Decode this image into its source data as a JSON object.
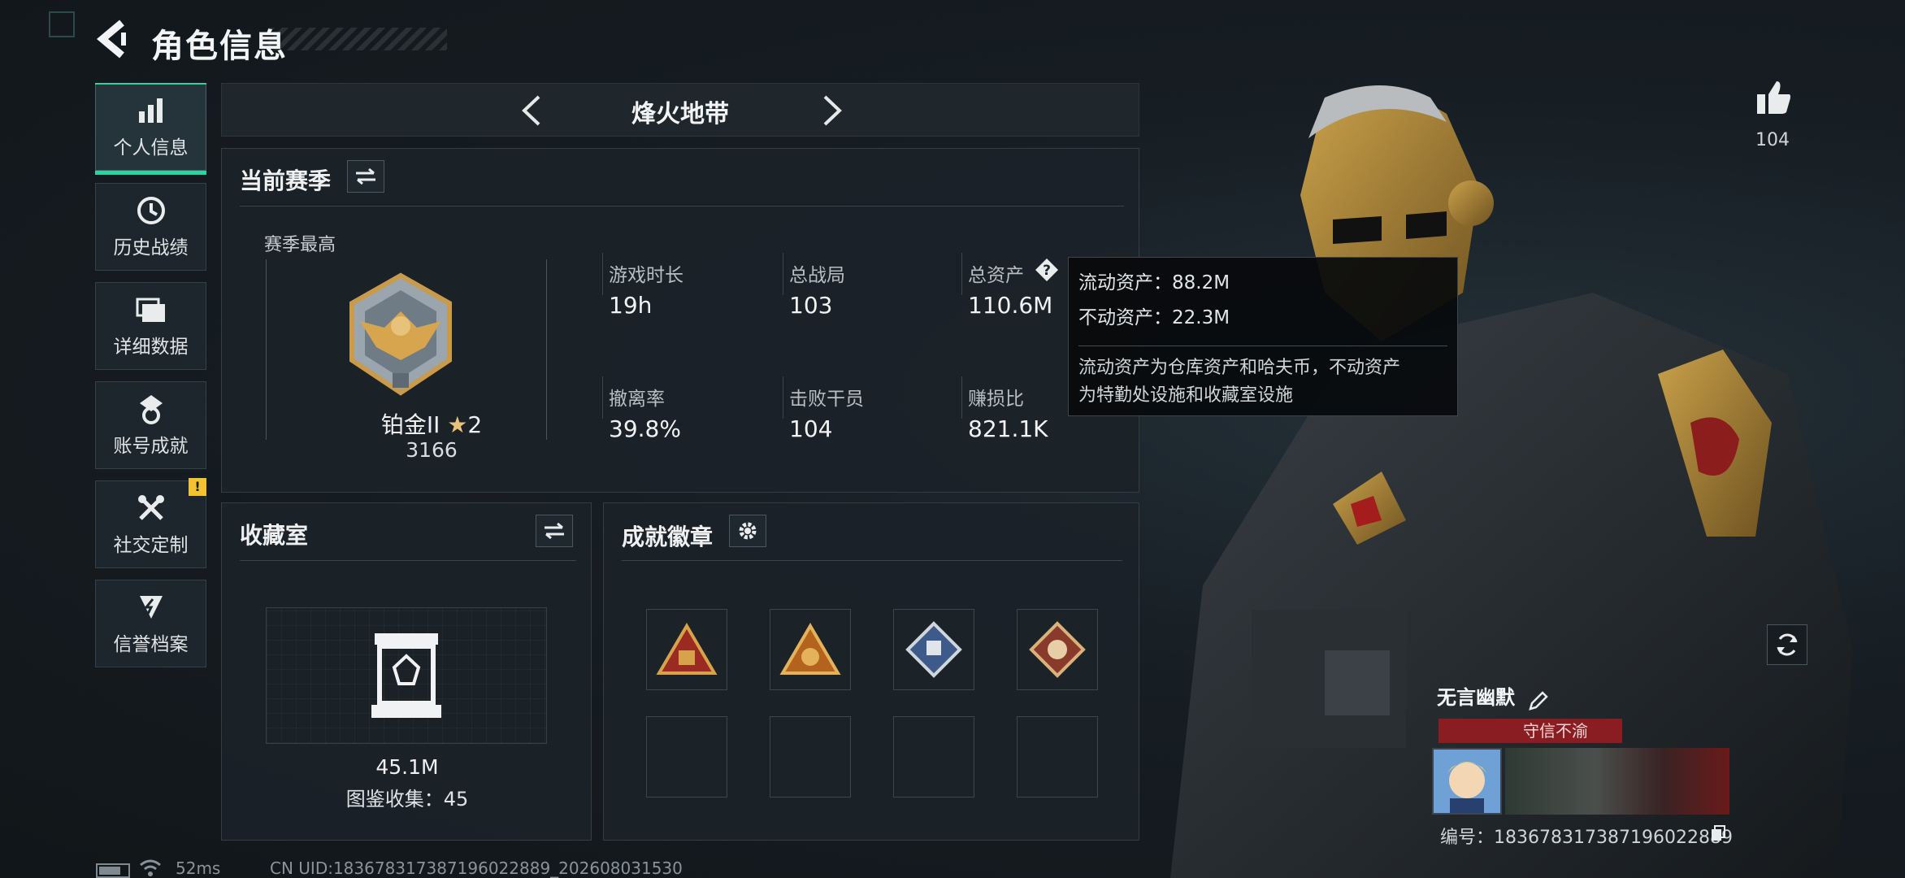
{
  "header": {
    "title": "角色信息"
  },
  "sidebar": {
    "items": [
      {
        "label": "个人信息"
      },
      {
        "label": "历史战绩"
      },
      {
        "label": "详细数据"
      },
      {
        "label": "账号成就"
      },
      {
        "label": "社交定制",
        "badge": "!"
      },
      {
        "label": "信誉档案"
      }
    ]
  },
  "mode_selector": {
    "title": "烽火地带"
  },
  "season": {
    "title": "当前赛季",
    "highest_label": "赛季最高",
    "rank_name": "铂金II",
    "rank_stars": "2",
    "rank_points": "3166",
    "stats": [
      {
        "label": "游戏时长",
        "value": "19h"
      },
      {
        "label": "总战局",
        "value": "103"
      },
      {
        "label": "总资产",
        "value": "110.6M"
      },
      {
        "label": "撤离率",
        "value": "39.8%"
      },
      {
        "label": "击败干员",
        "value": "104"
      },
      {
        "label": "赚损比",
        "value": "821.1K"
      }
    ]
  },
  "tooltip": {
    "liquid": "流动资产：88.2M",
    "fixed": "不动资产：22.3M",
    "desc_line1": "流动资产为仓库资产和哈夫币，不动资产",
    "desc_line2": "为特勤处设施和收藏室设施"
  },
  "collection": {
    "title": "收藏室",
    "value": "45.1M",
    "catalog": "图鉴收集：45"
  },
  "achievements": {
    "title": "成就徽章",
    "badges": [
      "triangle-red-badge",
      "triangle-orange-badge",
      "diamond-blue-badge",
      "diamond-red-badge",
      "empty",
      "empty",
      "empty",
      "empty"
    ]
  },
  "profile": {
    "likes": "104",
    "name": "无言幽默",
    "title": "守信不渝",
    "uid_label": "编号：",
    "uid_value": "18367831738719602288​9"
  },
  "footer": {
    "ping": "52ms",
    "uid_text": "CN UID:18367831738719602288​9_202608031530"
  },
  "colors": {
    "accent": "#2ad6a0",
    "warning": "#f2c230",
    "title_red": "#8a1d22"
  }
}
